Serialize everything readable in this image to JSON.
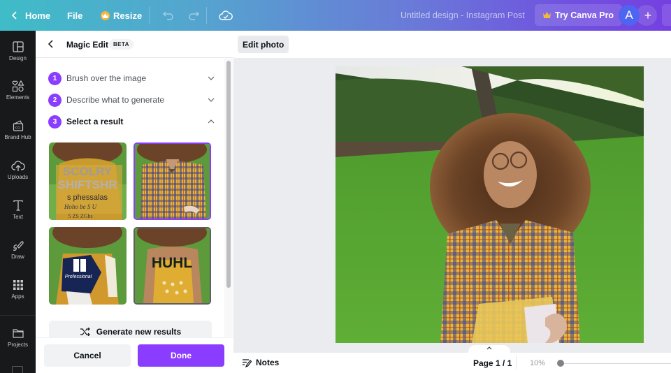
{
  "topbar": {
    "home_label": "Home",
    "file_label": "File",
    "resize_label": "Resize",
    "design_title": "Untitled design - Instagram Post",
    "pro_label": "Try Canva Pro",
    "avatar_initial": "A",
    "add_label": "+"
  },
  "rail": {
    "items": [
      {
        "label": "Design",
        "icon": "layout-icon"
      },
      {
        "label": "Elements",
        "icon": "shapes-icon"
      },
      {
        "label": "Brand Hub",
        "icon": "brand-hub-icon"
      },
      {
        "label": "Uploads",
        "icon": "cloud-upload-icon"
      },
      {
        "label": "Text",
        "icon": "text-icon"
      },
      {
        "label": "Draw",
        "icon": "draw-icon"
      },
      {
        "label": "Apps",
        "icon": "apps-grid-icon"
      },
      {
        "label": "Projects",
        "icon": "folder-icon"
      }
    ]
  },
  "panel": {
    "title": "Magic Edit",
    "badge": "BETA",
    "steps": [
      {
        "num": "1",
        "label": "Brush over the image",
        "expanded": false
      },
      {
        "num": "2",
        "label": "Describe what to generate",
        "expanded": false
      },
      {
        "num": "3",
        "label": "Select a result",
        "expanded": true
      }
    ],
    "results": [
      {
        "id": 1,
        "overlay_text": "SCOLRY SHIFTSHR",
        "selected": false
      },
      {
        "id": 2,
        "overlay_text": "",
        "selected": true
      },
      {
        "id": 3,
        "overlay_text": "Professional",
        "selected": false
      },
      {
        "id": 4,
        "overlay_text": "HUHL",
        "selected": false,
        "hovered": true
      }
    ],
    "generate_label": "Generate new results",
    "cancel_label": "Cancel",
    "done_label": "Done"
  },
  "canvas": {
    "edit_photo_label": "Edit photo"
  },
  "bottombar": {
    "notes_label": "Notes",
    "page_indicator": "Page 1 / 1",
    "zoom_level": "10%"
  },
  "colors": {
    "accent": "#8b3dff",
    "rail_bg": "#18191b",
    "canvas_bg": "#ebecf0"
  }
}
